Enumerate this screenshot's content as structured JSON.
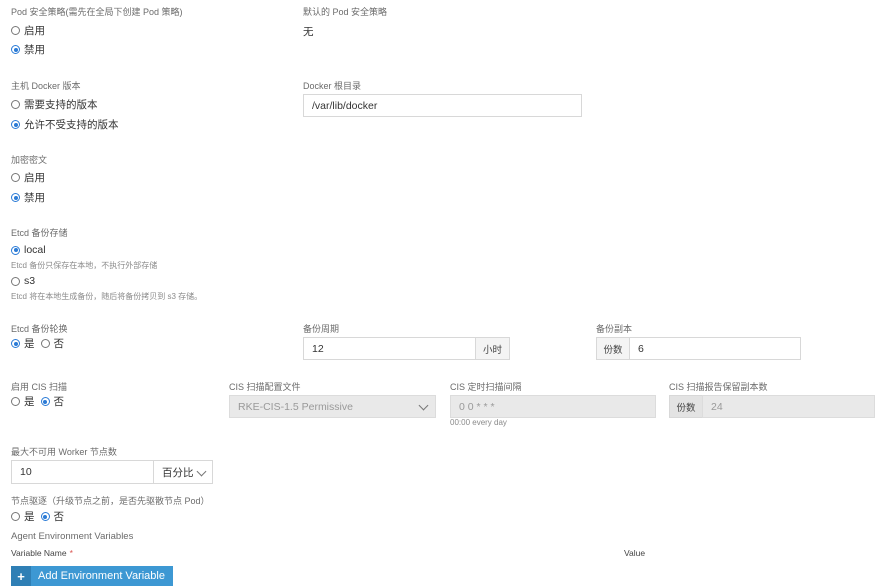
{
  "pod_security": {
    "label": "Pod 安全策略(需先在全局下创建 Pod 策略)",
    "options": [
      "启用",
      "禁用"
    ],
    "default_label": "默认的 Pod 安全策略",
    "default_value": "无"
  },
  "docker_version": {
    "label": "主机 Docker 版本",
    "options": [
      "需要支持的版本",
      "允许不受支持的版本"
    ],
    "root_label": "Docker 根目录",
    "root_value": "/var/lib/docker"
  },
  "encryption": {
    "label": "加密密文",
    "options": [
      "启用",
      "禁用"
    ]
  },
  "etcd_backup": {
    "label": "Etcd 备份存储",
    "local_label": "local",
    "local_help": "Etcd 备份只保存在本地，不执行外部存储",
    "s3_label": "s3",
    "s3_help": "Etcd 将在本地生成备份，随后将备份拷贝到 s3 存储。"
  },
  "etcd_rotation": {
    "label": "Etcd 备份轮换",
    "yes": "是",
    "no": "否",
    "period_label": "备份周期",
    "period_value": "12",
    "period_unit": "小时",
    "copies_label": "备份副本",
    "copies_prefix": "份数",
    "copies_value": "6"
  },
  "cis": {
    "label": "启用 CIS 扫描",
    "yes": "是",
    "no": "否",
    "profile_label": "CIS 扫描配置文件",
    "profile_value": "RKE-CIS-1.5 Permissive",
    "schedule_label": "CIS 定时扫描间隔",
    "schedule_value": "0 0 * * *",
    "schedule_help": "00:00 every day",
    "retention_label": "CIS 扫描报告保留副本数",
    "retention_prefix": "份数",
    "retention_value": "24"
  },
  "max_unavailable": {
    "label": "最大不可用 Worker 节点数",
    "value": "10",
    "unit": "百分比"
  },
  "drain": {
    "label": "节点驱逐（升级节点之前，是否先驱散节点 Pod）",
    "yes": "是",
    "no": "否"
  },
  "agent_env": {
    "title": "Agent Environment Variables",
    "col_name": "Variable Name",
    "required_mark": "*",
    "col_value": "Value",
    "add_button": "Add Environment Variable",
    "add_icon": "plus-icon"
  },
  "colors": {
    "accent": "#2b7bd6",
    "button": "#3d98d3",
    "button_icon_bg": "#2f7fb5",
    "disabled_bg": "#e9e9e9"
  }
}
